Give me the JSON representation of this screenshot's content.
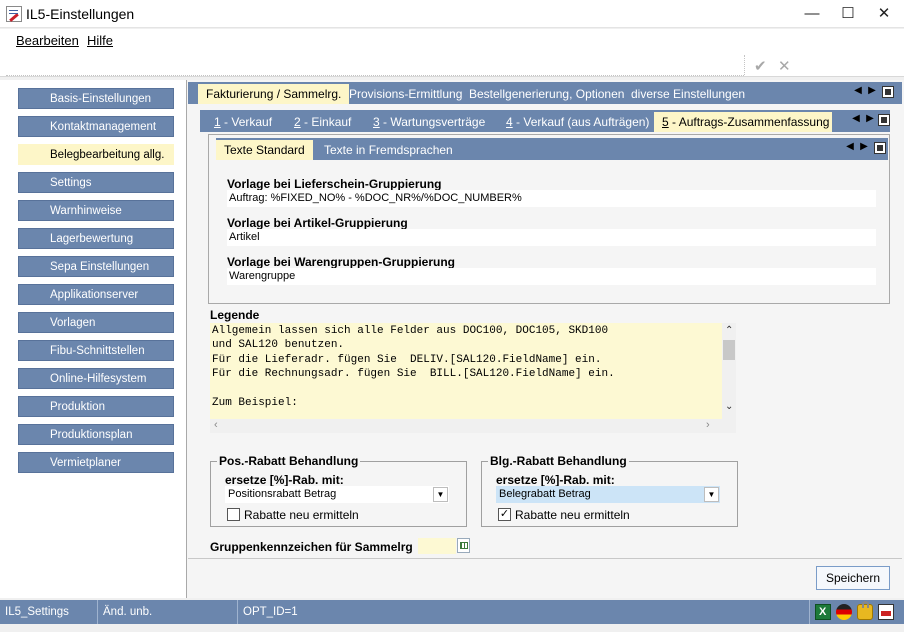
{
  "window": {
    "title": "IL5-Einstellungen",
    "minimize": "—",
    "maximize": "☐",
    "close": "✕"
  },
  "menu": [
    {
      "label": "Bearbeiten"
    },
    {
      "label": "Hilfe"
    }
  ],
  "toolbar": {
    "confirm_icon": "✔",
    "cancel_icon": "✕"
  },
  "sidebar": {
    "items": [
      {
        "label": "Basis-Einstellungen"
      },
      {
        "label": "Kontaktmanagement"
      },
      {
        "label": "Belegbearbeitung allg."
      },
      {
        "label": "Settings"
      },
      {
        "label": "Warnhinweise"
      },
      {
        "label": "Lagerbewertung"
      },
      {
        "label": "Sepa Einstellungen"
      },
      {
        "label": "Applikationserver"
      },
      {
        "label": "Vorlagen"
      },
      {
        "label": "Fibu-Schnittstellen"
      },
      {
        "label": "Online-Hilfesystem"
      },
      {
        "label": "Produktion"
      },
      {
        "label": "Produktionsplan"
      },
      {
        "label": "Vermietplaner"
      }
    ],
    "active_index": 2
  },
  "tabs_top": [
    {
      "label": "Fakturierung / Sammelrg."
    },
    {
      "label": "Provisions-Ermittlung"
    },
    {
      "label": "Bestellgenerierung, Optionen"
    },
    {
      "label": "diverse Einstellungen"
    }
  ],
  "tabs_second": [
    {
      "num": "1",
      "label": " - Verkauf"
    },
    {
      "num": "2",
      "label": " - Einkauf"
    },
    {
      "num": "3",
      "label": " - Wartungsverträge"
    },
    {
      "num": "4",
      "label": " - Verkauf (aus Aufträgen)"
    },
    {
      "num": "5",
      "label": " - Auftrags-Zusammenfassung"
    }
  ],
  "tabs_third": [
    {
      "label": "Texte Standard"
    },
    {
      "label": "Texte in Fremdsprachen"
    }
  ],
  "fields": [
    {
      "label": "Vorlage bei Lieferschein-Gruppierung",
      "value": "Auftrag: %FIXED_NO% - %DOC_NR%/%DOC_NUMBER%"
    },
    {
      "label": "Vorlage bei Artikel-Gruppierung",
      "value": "Artikel"
    },
    {
      "label": "Vorlage bei Warengruppen-Gruppierung",
      "value": "Warengruppe"
    }
  ],
  "legend": {
    "title": "Legende",
    "text": "Allgemein lassen sich alle Felder aus DOC100, DOC105, SKD100\nund SAL120 benutzen.\nFür die Lieferadr. fügen Sie  DELIV.[SAL120.FieldName] ein.\nFür die Rechnungsadr. fügen Sie  BILL.[SAL120.FieldName] ein.\n\nZum Beispiel:"
  },
  "pos_rabatt": {
    "title": "Pos.-Rabatt Behandlung",
    "sub_label": "ersetze [%]-Rab.  mit:",
    "combo_value": "Positionsrabatt Betrag",
    "checkbox_label": "Rabatte neu ermitteln",
    "checked": false
  },
  "blg_rabatt": {
    "title": "Blg.-Rabatt Behandlung",
    "sub_label": "ersetze [%]-Rab.  mit:",
    "combo_value": "Belegrabatt Betrag",
    "checkbox_label": "Rabatte neu ermitteln",
    "checked": true
  },
  "gruppen": {
    "label": "Gruppenkennzeichen für Sammelrg",
    "value": ""
  },
  "save_button": "Speichern",
  "status": [
    {
      "text": "IL5_Settings"
    },
    {
      "text": "Änd. unb."
    },
    {
      "text": "OPT_ID=1"
    }
  ],
  "colors": {
    "accent": "#6b86ad",
    "active_tab": "#fdf6c8",
    "legend_bg": "#fdf9d3",
    "selection": "#cce4f7"
  }
}
